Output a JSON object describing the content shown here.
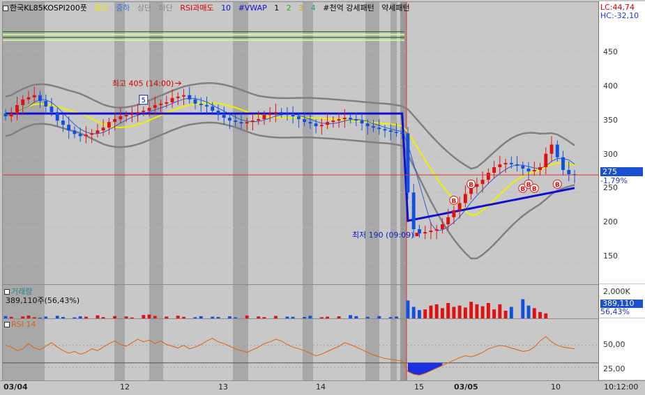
{
  "legend": {
    "symbol": "한국KL85KOSPI200풋",
    "items": [
      {
        "label": "중단",
        "color": "#e8e800"
      },
      {
        "label": "중하",
        "color": "#3a6fd8"
      },
      {
        "label": "상단",
        "color": "#888888"
      },
      {
        "label": "하단",
        "color": "#888888"
      },
      {
        "label": "RSI과매도",
        "color": "#d80000"
      },
      {
        "label": "10",
        "color": "#1010d0"
      },
      {
        "label": "#VWAP",
        "color": "#1010d0"
      },
      {
        "label": "1",
        "color": "#000000"
      },
      {
        "label": "2",
        "color": "#20b020"
      },
      {
        "label": "3",
        "color": "#e0a000"
      },
      {
        "label": "4",
        "color": "#20a080"
      },
      {
        "label": "#천억 강세패턴",
        "color": "#000000"
      },
      {
        "label": "약세패턴",
        "color": "#000000"
      }
    ]
  },
  "price_axis": {
    "ticks": [
      "450",
      "400",
      "350",
      "300",
      "250",
      "200",
      "150"
    ],
    "lc": "LC:44,74",
    "hc": "HC:-32,10",
    "current": "275",
    "change": "-1,79%"
  },
  "annotations": {
    "high": "최고 405 (14:00)",
    "low": "최저 190 (09:09)",
    "five_marker": "5",
    "b_marker": "B"
  },
  "volume": {
    "title": "거래량",
    "value": "389,110주(56,43%)",
    "axis_top": "2,000K",
    "axis_current": "389,110",
    "axis_pct": "56,43%"
  },
  "rsi": {
    "title": "RSI 14",
    "ticks": [
      "50,00",
      "25,00"
    ]
  },
  "x_axis": {
    "labels": [
      "03/04",
      "12",
      "13",
      "14",
      "15",
      "03/05",
      "10",
      "10:12:00"
    ]
  },
  "chart_data": [
    {
      "type": "candlestick",
      "title": "한국KL85KOSPI200풋",
      "ylim": [
        120,
        520
      ],
      "yticks": [
        150,
        200,
        250,
        300,
        350,
        400,
        450
      ],
      "closes": [
        358,
        362,
        374,
        382,
        385,
        388,
        380,
        372,
        364,
        352,
        346,
        338,
        333,
        330,
        332,
        334,
        338,
        342,
        350,
        354,
        358,
        360,
        362,
        364,
        366,
        370,
        374,
        376,
        378,
        384,
        386,
        388,
        382,
        376,
        374,
        372,
        366,
        360,
        356,
        352,
        350,
        348,
        350,
        352,
        354,
        360,
        362,
        364,
        362,
        360,
        358,
        354,
        350,
        348,
        344,
        346,
        350,
        352,
        354,
        356,
        354,
        352,
        348,
        344,
        342,
        340,
        338,
        336,
        335,
        334,
        250,
        198,
        192,
        194,
        196,
        198,
        205,
        215,
        225,
        235,
        248,
        258,
        262,
        268,
        278,
        286,
        290,
        292,
        290,
        288,
        284,
        280,
        282,
        286,
        305,
        318,
        300,
        282,
        276,
        275
      ],
      "current": 275,
      "high": {
        "value": 405,
        "label": "최고 405 (14:00)"
      },
      "low": {
        "value": 190,
        "label": "최저 190 (09:09)"
      },
      "overlays": [
        "중단",
        "중하",
        "상단",
        "하단",
        "10",
        "#VWAP"
      ],
      "level_line": 275
    },
    {
      "type": "bar",
      "title": "거래량",
      "ylim": [
        0,
        2400000
      ],
      "values": [
        180000,
        120000,
        0,
        150000,
        220000,
        90000,
        60000,
        140000,
        0,
        200000,
        110000,
        0,
        80000,
        160000,
        130000,
        0,
        240000,
        100000,
        0,
        180000,
        0,
        150000,
        70000,
        0,
        260000,
        300000,
        190000,
        0,
        140000,
        0,
        210000,
        120000,
        0,
        90000,
        170000,
        0,
        130000,
        110000,
        0,
        160000,
        80000,
        0,
        220000,
        0,
        150000,
        100000,
        0,
        190000,
        0,
        140000,
        120000,
        0,
        110000,
        200000,
        0,
        90000,
        130000,
        0,
        160000,
        0,
        250000,
        170000,
        0,
        120000,
        0,
        180000,
        0,
        100000,
        140000,
        0,
        1400000,
        900000,
        650000,
        700000,
        1000000,
        1100000,
        800000,
        1200000,
        900000,
        1000000,
        850000,
        1300000,
        1100000,
        950000,
        1200000,
        700000,
        1100000,
        600000,
        900000,
        0,
        1500000,
        1000000,
        800000,
        500000,
        389110
      ],
      "current": 389110,
      "current_pct": "56,43%"
    },
    {
      "type": "line",
      "title": "RSI 14",
      "ylim": [
        10,
        80
      ],
      "yticks": [
        25,
        50
      ],
      "values": [
        50,
        48,
        44,
        46,
        52,
        47,
        45,
        49,
        53,
        48,
        44,
        41,
        43,
        40,
        42,
        46,
        44,
        48,
        52,
        55,
        51,
        49,
        53,
        57,
        54,
        56,
        52,
        55,
        51,
        49,
        47,
        50,
        46,
        48,
        51,
        55,
        58,
        54,
        52,
        49,
        46,
        44,
        42,
        45,
        48,
        52,
        54,
        57,
        55,
        51,
        48,
        46,
        44,
        41,
        38,
        40,
        43,
        46,
        49,
        53,
        51,
        48,
        45,
        42,
        39,
        37,
        35,
        34,
        33,
        32,
        20,
        17,
        16,
        18,
        21,
        24,
        27,
        30,
        33,
        36,
        38,
        37,
        39,
        42,
        46,
        48,
        50,
        49,
        47,
        45,
        43,
        44,
        48,
        55,
        60,
        54,
        50,
        48,
        47,
        46
      ],
      "oversold_fill_below": 30
    }
  ]
}
